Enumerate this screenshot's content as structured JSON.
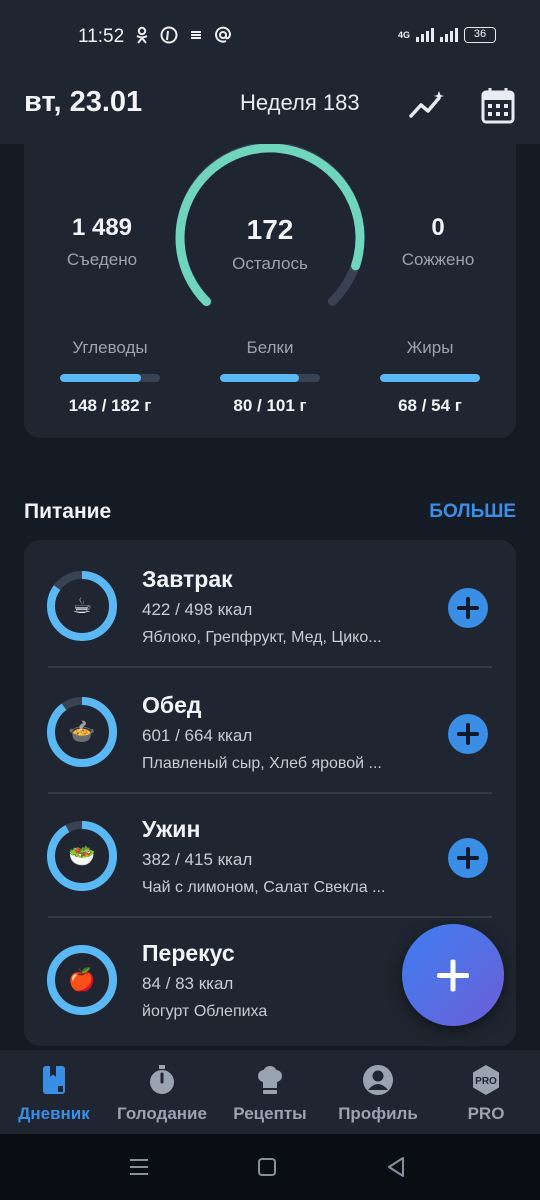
{
  "status_bar": {
    "time": "11:52",
    "battery": "36",
    "network": "4G"
  },
  "header": {
    "date": "вт, 23.01",
    "week": "Неделя 183"
  },
  "summary": {
    "eaten": {
      "value": "1 489",
      "label": "Съедено"
    },
    "remaining": {
      "value": "172",
      "label": "Осталось",
      "progress": 0.9
    },
    "burned": {
      "value": "0",
      "label": "Сожжено"
    },
    "macros": [
      {
        "label": "Углеводы",
        "value": "148 / 182 г",
        "progress": 0.81
      },
      {
        "label": "Белки",
        "value": "80 / 101 г",
        "progress": 0.79
      },
      {
        "label": "Жиры",
        "value": "68 / 54 г",
        "progress": 1.0
      }
    ]
  },
  "nutrition": {
    "title": "Питание",
    "more": "БОЛЬШЕ",
    "meals": [
      {
        "name": "Завтрак",
        "kcal": "422 / 498 ккал",
        "items": "Яблоко, Грепфрукт, Мед, Цико...",
        "icon": "coffee-icon",
        "emoji": "☕",
        "progress": 0.85
      },
      {
        "name": "Обед",
        "kcal": "601 / 664 ккал",
        "items": "Плавленый сыр, Хлеб яровой  ...",
        "icon": "soup-icon",
        "emoji": "🍲",
        "progress": 0.9
      },
      {
        "name": "Ужин",
        "kcal": "382 / 415 ккал",
        "items": "Чай с лимоном, Салат Свекла ...",
        "icon": "salad-icon",
        "emoji": "🥗",
        "progress": 0.92
      },
      {
        "name": "Перекус",
        "kcal": "84 / 83 ккал",
        "items": "йогурт Облепиха",
        "icon": "apple-icon",
        "emoji": "🍎",
        "progress": 1.0
      }
    ]
  },
  "tabs": [
    {
      "label": "Дневник",
      "icon": "diary-icon",
      "active": true
    },
    {
      "label": "Голодание",
      "icon": "stopwatch-icon",
      "active": false
    },
    {
      "label": "Рецепты",
      "icon": "chef-hat-icon",
      "active": false
    },
    {
      "label": "Профиль",
      "icon": "profile-icon",
      "active": false
    },
    {
      "label": "PRO",
      "icon": "pro-badge-icon",
      "active": false
    }
  ],
  "colors": {
    "accent": "#3a8ee6",
    "ring": "#6fd6bd",
    "macro_bar": "#5ab8f5",
    "background": "#151b24",
    "card": "#1f2631"
  }
}
